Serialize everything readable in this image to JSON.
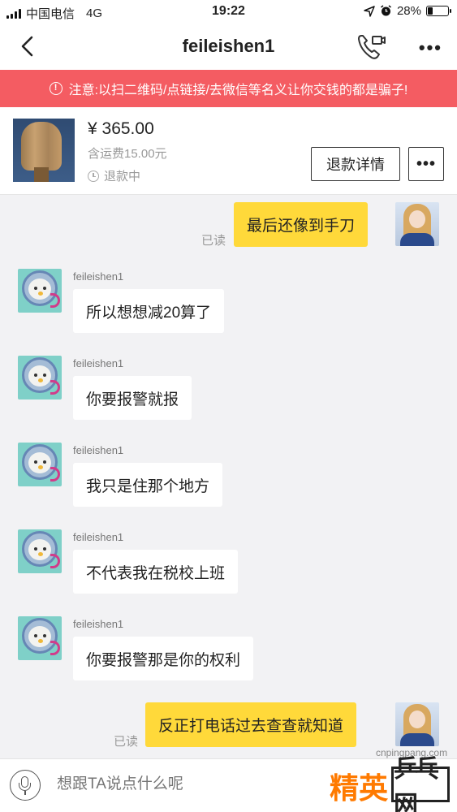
{
  "status": {
    "carrier": "中国电信",
    "network": "4G",
    "time": "19:22",
    "battery": "28%",
    "battery_level": 0.28
  },
  "nav": {
    "title": "feileishen1"
  },
  "warning": {
    "text": "注意:以扫二维码/点链接/去微信等名义让你交钱的都是骗子!"
  },
  "product": {
    "price": "¥ 365.00",
    "shipping": "含运费15.00元",
    "state": "退款中",
    "refund_button": "退款详情"
  },
  "messages": [
    {
      "dir": "out",
      "text": "最后还像到手刀",
      "read": "已读"
    },
    {
      "dir": "in",
      "sender": "feileishen1",
      "text": "所以想想减20算了"
    },
    {
      "dir": "in",
      "sender": "feileishen1",
      "text": "你要报警就报"
    },
    {
      "dir": "in",
      "sender": "feileishen1",
      "text": "我只是住那个地方"
    },
    {
      "dir": "in",
      "sender": "feileishen1",
      "text": "不代表我在税校上班"
    },
    {
      "dir": "in",
      "sender": "feileishen1",
      "text": "你要报警那是你的权利"
    },
    {
      "dir": "out",
      "text": "反正打电话过去查查就知道",
      "read": "已读"
    }
  ],
  "input": {
    "placeholder": "想跟TA说点什么呢"
  },
  "watermark": {
    "url": "cnpingpang.com",
    "brand": "精英",
    "site": "乒乓网"
  }
}
